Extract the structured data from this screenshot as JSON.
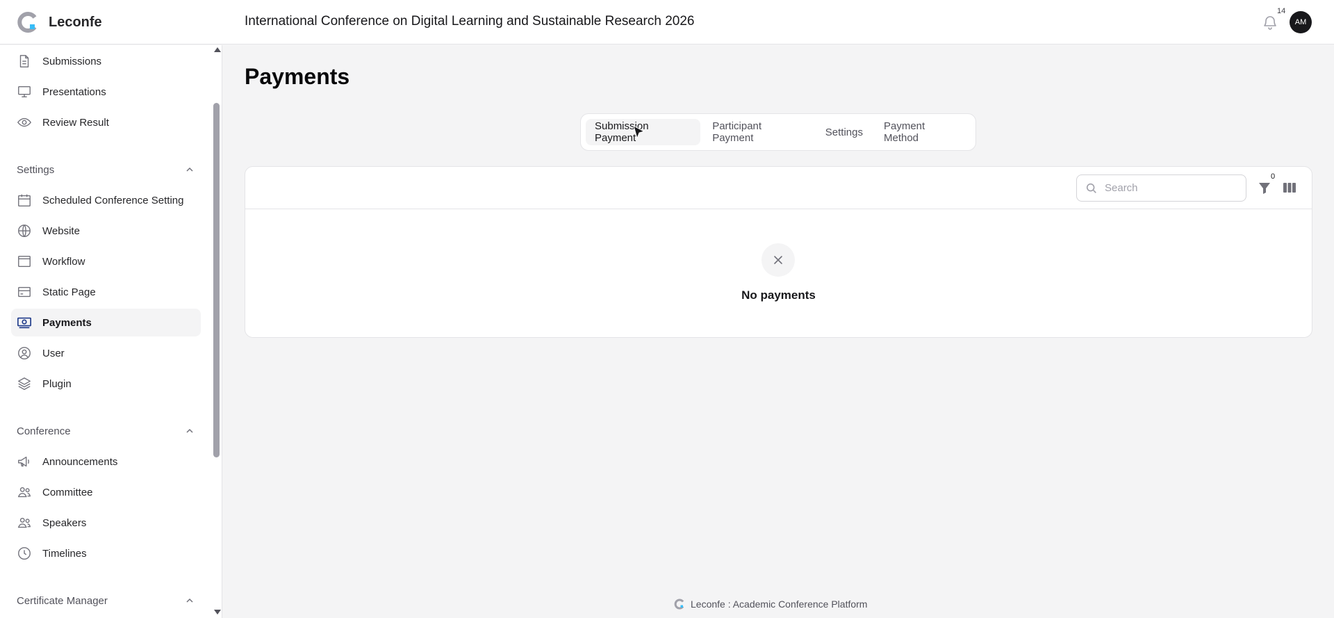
{
  "app": {
    "brand_name": "Leconfe"
  },
  "header": {
    "conference_title": "International Conference on Digital Learning and Sustainable Research 2026",
    "notifications_count": "14",
    "avatar_initials": "AM"
  },
  "sidebar": {
    "top_items": [
      {
        "label": "Submissions",
        "icon": "document-icon"
      },
      {
        "label": "Presentations",
        "icon": "monitor-icon"
      },
      {
        "label": "Review Result",
        "icon": "eye-icon"
      }
    ],
    "groups": [
      {
        "label": "Settings",
        "items": [
          {
            "label": "Scheduled Conference Setting",
            "icon": "calendar-icon"
          },
          {
            "label": "Website",
            "icon": "globe-icon"
          },
          {
            "label": "Workflow",
            "icon": "window-icon"
          },
          {
            "label": "Static Page",
            "icon": "card-icon"
          },
          {
            "label": "Payments",
            "icon": "payment-icon",
            "active": true
          },
          {
            "label": "User",
            "icon": "user-circle-icon"
          },
          {
            "label": "Plugin",
            "icon": "layers-icon"
          }
        ]
      },
      {
        "label": "Conference",
        "items": [
          {
            "label": "Announcements",
            "icon": "megaphone-icon"
          },
          {
            "label": "Committee",
            "icon": "users-icon"
          },
          {
            "label": "Speakers",
            "icon": "users-icon"
          },
          {
            "label": "Timelines",
            "icon": "clock-icon"
          }
        ]
      },
      {
        "label": "Certificate Manager",
        "items": []
      }
    ]
  },
  "main": {
    "title": "Payments",
    "tabs": [
      {
        "label": "Submission Payment",
        "active": true
      },
      {
        "label": "Participant Payment"
      },
      {
        "label": "Settings"
      },
      {
        "label": "Payment Method"
      }
    ],
    "table": {
      "search_placeholder": "Search",
      "filter_count": "0",
      "empty_message": "No payments"
    }
  },
  "footer": {
    "text": "Leconfe : Academic Conference Platform"
  },
  "colors": {
    "accent": "#18181b",
    "logo_blue": "#38bdf8",
    "logo_gray": "#a1a1aa"
  }
}
